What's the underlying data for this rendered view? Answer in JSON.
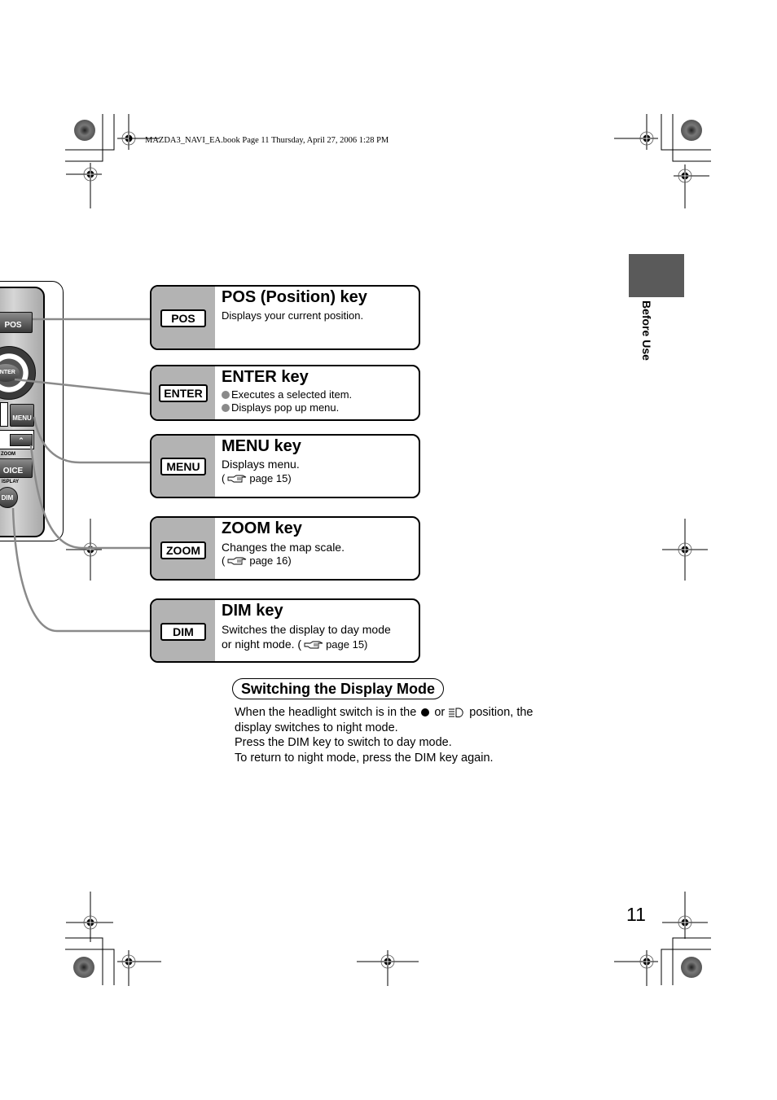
{
  "print_header": "MAZDA3_NAVI_EA.book  Page 11  Thursday, April 27, 2006  1:28 PM",
  "side_tab": {
    "label": "Before Use",
    "color": "#5a5a5a"
  },
  "page_number": "11",
  "remote": {
    "buttons": {
      "pos": "POS",
      "enter": "ENTER",
      "menu": "MENU",
      "zoom_label": "ZOOM",
      "voice": "OICE",
      "display_label": "ISPLAY",
      "dim": "DIM"
    }
  },
  "keys": [
    {
      "id": "pos",
      "label": "POS",
      "title": "POS (Position) key",
      "lines": [
        "Displays your current position."
      ]
    },
    {
      "id": "enter",
      "label": "ENTER",
      "title": "ENTER key",
      "bullets": [
        "Executes a selected item.",
        "Displays pop up menu."
      ]
    },
    {
      "id": "menu",
      "label": "MENU",
      "title": "MENU key",
      "lines": [
        "Displays menu."
      ],
      "ref": {
        "prefix": "(",
        "text": "page 15)"
      }
    },
    {
      "id": "zoom",
      "label": "ZOOM",
      "title": "ZOOM key",
      "lines": [
        "Changes the map scale."
      ],
      "ref": {
        "prefix": "(",
        "text": "page 16)"
      }
    },
    {
      "id": "dim",
      "label": "DIM",
      "title": "DIM key",
      "lines": [
        "Switches the display to day mode",
        "or night mode. ("
      ],
      "ref": {
        "text": "page 15)"
      }
    }
  ],
  "section": {
    "title": "Switching the Display Mode",
    "line1_a": "When the headlight switch is in the",
    "line1_b": "or",
    "line1_c": "position, the",
    "line2": "display switches to night mode.",
    "line3": "Press the DIM key to switch to day mode.",
    "line4": "To return to night mode, press the DIM key again."
  },
  "colors": {
    "key_sidebar": "#b3b3b3",
    "connector_line": "#8a8a8a",
    "bullet": "#8a8a8a"
  }
}
